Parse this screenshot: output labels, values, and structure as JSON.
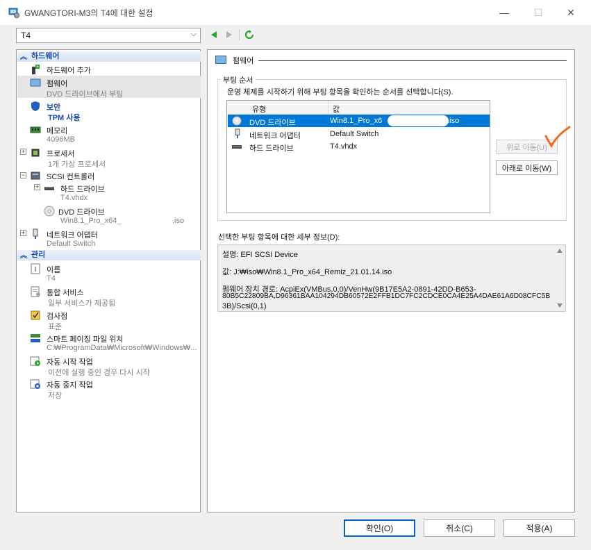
{
  "window": {
    "title": "GWANGTORI-M3의 T4에 대한 설정",
    "minimize": "—",
    "maximize": "☐",
    "close": "✕"
  },
  "vm_select": {
    "value": "T4"
  },
  "sidebar": {
    "hardware_header": "하드웨어",
    "management_header": "관리",
    "items": {
      "add_hardware": {
        "title": "하드웨어 추가"
      },
      "firmware": {
        "title": "펌웨어",
        "sub": "DVD 드라이브에서 부팅"
      },
      "security": {
        "title": "보안",
        "sub": "TPM 사용"
      },
      "memory": {
        "title": "메모리",
        "sub": "4096MB"
      },
      "processor": {
        "title": "프로세서",
        "sub": "1개 가상 프로세서"
      },
      "scsi": {
        "title": "SCSI 컨트롤러"
      },
      "hdd": {
        "title": "하드 드라이브",
        "sub": "T4.vhdx"
      },
      "dvd": {
        "title": "DVD 드라이브",
        "sub": "Win8.1_Pro_x64_",
        "sub_tail": ".iso"
      },
      "nic": {
        "title": "네트워크 어댑터",
        "sub": "Default Switch"
      },
      "name": {
        "title": "이름",
        "sub": "T4"
      },
      "integration": {
        "title": "통합 서비스",
        "sub": "일부 서비스가 제공됨"
      },
      "checkpoint": {
        "title": "검사점",
        "sub": "표준"
      },
      "paging": {
        "title": "스마트 페이징 파일 위치",
        "sub": "C:₩ProgramData₩Microsoft₩Windows₩..."
      },
      "autostart": {
        "title": "자동 시작 작업",
        "sub": "이전에 실행 중인 경우 다시 시작"
      },
      "autostop": {
        "title": "자동 중지 작업",
        "sub": "저장"
      }
    }
  },
  "main": {
    "section_title": "펌웨어",
    "boot_group": "부팅 순서",
    "boot_desc": "운영 체제를 시작하기 위해 부팅 항목을 확인하는 순서를 선택합니다(S).",
    "columns": {
      "type": "유형",
      "value": "값"
    },
    "boot_entries": [
      {
        "type": "DVD 드라이브",
        "value": "Win8.1_Pro_x6",
        "value_tail": "o.iso"
      },
      {
        "type": "네트워크 어댑터",
        "value": "Default Switch"
      },
      {
        "type": "하드 드라이브",
        "value": "T4.vhdx"
      }
    ],
    "move_up": "위로 이동(U)",
    "move_down": "아래로 이동(W)",
    "details_label": "선택한 부팅 항목에 대한 세부 정보(D):",
    "details": {
      "line1": "설명: EFI SCSI Device",
      "line2": "값: J:₩iso₩Win8.1_Pro_x64_Remiz_21.01.14.iso",
      "line3": "펌웨어 장치 경로: AcpiEx(VMBus,0,0)/VenHw(9B17E5A2-0891-42DD-B653-",
      "line4": "80B5C22809BA,D96361BAA104294DB60572E2FFB1DC7FC2CDCE0CA4E25A4DAE61A6D08CFC5B",
      "line5": "3B)/Scsi(0,1)"
    }
  },
  "footer": {
    "ok": "확인(O)",
    "cancel": "취소(C)",
    "apply": "적용(A)"
  },
  "colors": {
    "selection": "#0078d7",
    "header_blue": "#1a4aa8",
    "annotation": "#f06a1e"
  }
}
